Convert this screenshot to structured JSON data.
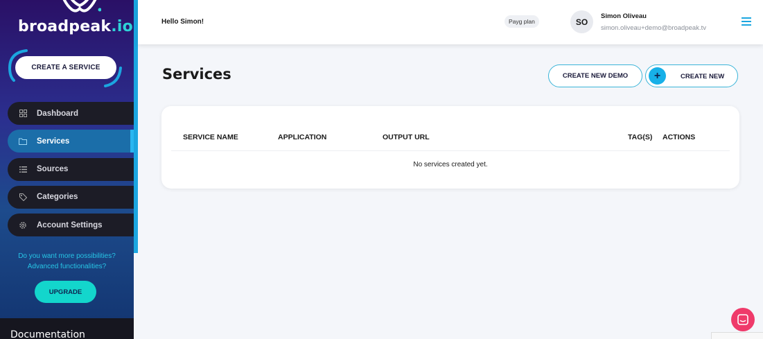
{
  "brand": {
    "name": "broadpeak",
    "suffix": ".io"
  },
  "sidebar": {
    "create_service_label": "CREATE A SERVICE",
    "items": [
      {
        "label": "Dashboard",
        "icon": "grid-icon",
        "active": false
      },
      {
        "label": "Services",
        "icon": "folder-icon",
        "active": true
      },
      {
        "label": "Sources",
        "icon": "list-icon",
        "active": false
      },
      {
        "label": "Categories",
        "icon": "tags-icon",
        "active": false
      },
      {
        "label": "Account Settings",
        "icon": "gear-icon",
        "active": false
      }
    ],
    "promo_line1": "Do you want more possibilities?",
    "promo_line2": "Advanced functionalities?",
    "upgrade_label": "UPGRADE",
    "documentation_label": "Documentation"
  },
  "header": {
    "greeting": "Hello Simon!",
    "plan": "Payg plan",
    "avatar_initials": "SO",
    "user_name": "Simon Oliveau",
    "user_email": "simon.oliveau+demo@broadpeak.tv"
  },
  "main": {
    "title": "Services",
    "create_demo_label": "CREATE NEW DEMO",
    "create_new_label": "CREATE NEW",
    "table": {
      "columns": [
        "SERVICE NAME",
        "APPLICATION",
        "OUTPUT URL",
        "TAG(S)",
        "ACTIONS"
      ],
      "empty_message": "No services created yet."
    }
  },
  "colors": {
    "accent": "#1ba6e0",
    "upgrade": "#13d6cc",
    "chat": "#ef3a6a",
    "active_nav": "#1b6ea9"
  }
}
